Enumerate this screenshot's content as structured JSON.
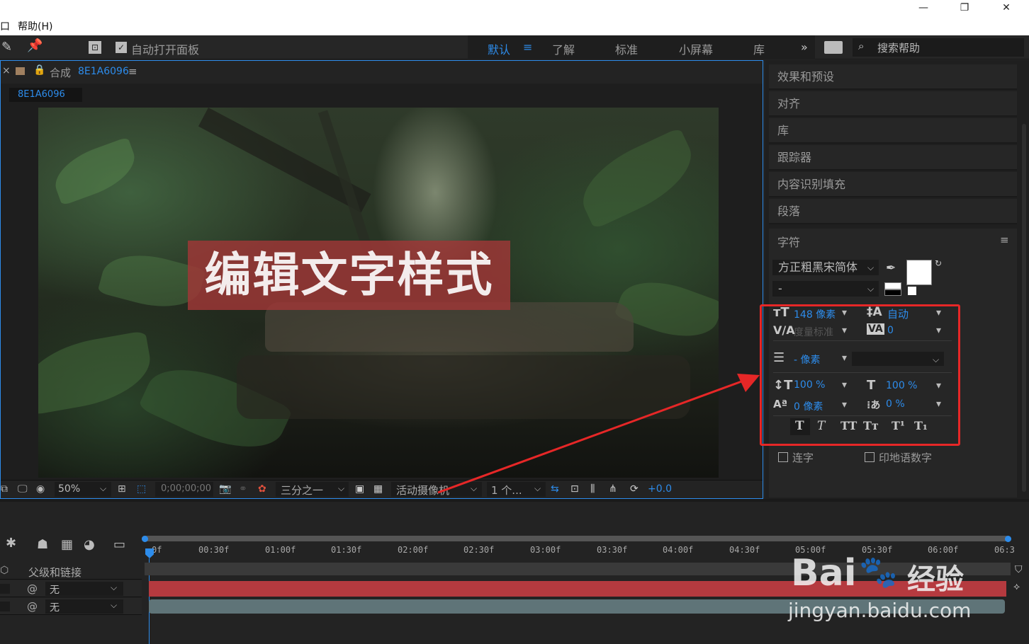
{
  "menubar": {
    "window_fragment": "口",
    "help": "帮助(H)"
  },
  "toolbar": {
    "auto_open_panel": "自动打开面板",
    "workspaces": [
      "默认",
      "了解",
      "标准",
      "小屏幕",
      "库"
    ],
    "more": "»",
    "search_help": "搜索帮助"
  },
  "composition": {
    "tab_close": "×",
    "tab_prefix": "合成",
    "tab_name": "8E1A6096",
    "menu_icon": "≡",
    "subtab": "8E1A6096",
    "overlay_text": "编辑文字样式"
  },
  "comp_footer": {
    "zoom": "50%",
    "timecode": "0;00;00;00",
    "grid": "三分之一",
    "camera": "活动摄像机",
    "views": "1 个...",
    "exposure": "+0.0"
  },
  "right_panels": [
    "效果和预设",
    "对齐",
    "库",
    "跟踪器",
    "内容识别填充",
    "段落"
  ],
  "character": {
    "title": "字符",
    "font_family": "方正粗黑宋简体",
    "font_style": "-",
    "font_size": "148 像素",
    "leading": "自动",
    "kerning": "度量标准",
    "tracking": "0",
    "stroke_width": "- 像素",
    "vscale": "100 %",
    "hscale": "100 %",
    "baseline": "0 像素",
    "tsume": "0 %",
    "styles": [
      "T",
      "T",
      "TT",
      "Tт",
      "T¹",
      "T₁"
    ],
    "ligatures": "连字",
    "hindi_digits": "印地语数字"
  },
  "timeline": {
    "column_header": "父级和链接",
    "layers": [
      {
        "parent": "无"
      },
      {
        "parent": "无"
      }
    ],
    "ruler": [
      "0f",
      "00:30f",
      "01:00f",
      "01:30f",
      "02:00f",
      "02:30f",
      "03:00f",
      "03:30f",
      "04:00f",
      "04:30f",
      "05:00f",
      "05:30f",
      "06:00f",
      "06:3"
    ]
  },
  "watermark": {
    "brand": "Bai",
    "brand_cn": "经验",
    "url": "jingyan.baidu.com"
  },
  "colors": {
    "accent": "#2d8ceb",
    "highlight": "#e62727",
    "layer_red": "#b53a3f",
    "layer_teal": "#5f7478"
  }
}
